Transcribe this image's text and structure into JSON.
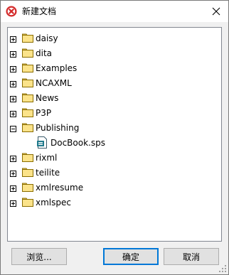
{
  "window": {
    "title": "新建文档",
    "accent_color": "#0078d7",
    "app_icon": "altova-x-icon"
  },
  "tree": {
    "items": [
      {
        "label": "daisy",
        "type": "folder",
        "state": "collapsed"
      },
      {
        "label": "dita",
        "type": "folder",
        "state": "collapsed"
      },
      {
        "label": "Examples",
        "type": "folder",
        "state": "collapsed"
      },
      {
        "label": "NCAXML",
        "type": "folder",
        "state": "collapsed"
      },
      {
        "label": "News",
        "type": "folder",
        "state": "collapsed"
      },
      {
        "label": "P3P",
        "type": "folder",
        "state": "collapsed"
      },
      {
        "label": "Publishing",
        "type": "folder",
        "state": "expanded"
      },
      {
        "label": "DocBook.sps",
        "type": "file",
        "state": "selected"
      },
      {
        "label": "rixml",
        "type": "folder",
        "state": "collapsed"
      },
      {
        "label": "teilite",
        "type": "folder",
        "state": "collapsed"
      },
      {
        "label": "xmlresume",
        "type": "folder",
        "state": "collapsed"
      },
      {
        "label": "xmlspec",
        "type": "folder",
        "state": "collapsed"
      }
    ]
  },
  "buttons": {
    "browse": "浏览...",
    "ok": "确定",
    "cancel": "取消"
  }
}
